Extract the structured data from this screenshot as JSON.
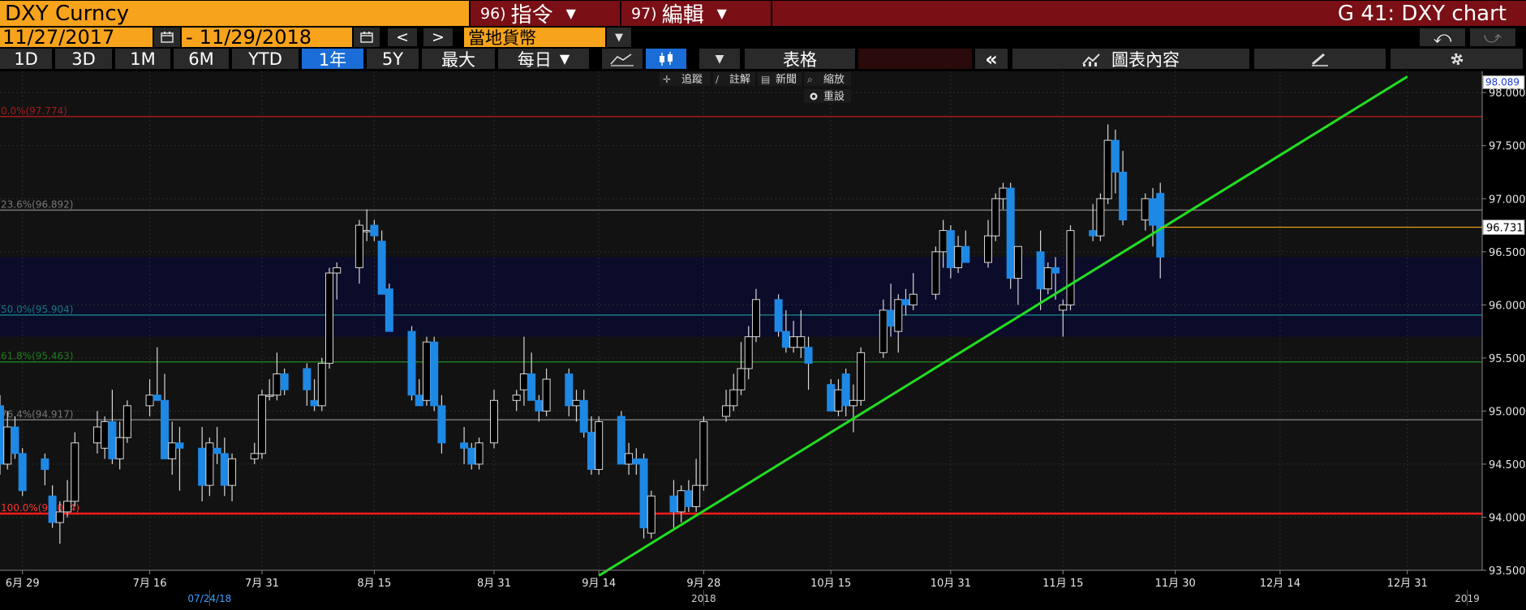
{
  "header": {
    "security": "DXY Curncy",
    "cmd96_num": "96)",
    "cmd96_label": "指令",
    "cmd97_num": "97)",
    "cmd97_label": "編輯",
    "title": "G 41: DXY chart"
  },
  "daterow": {
    "start_date": "11/27/2017",
    "dash": "-",
    "end_date": "11/29/2018",
    "prev": "<",
    "next": ">",
    "currency": "當地貨幣",
    "undo": "⤺",
    "redo": "⤻"
  },
  "toolbar": {
    "periods": [
      "1D",
      "3D",
      "1M",
      "6M",
      "YTD",
      "1年",
      "5Y",
      "最大"
    ],
    "active_period": "1年",
    "frequency": "每日",
    "table_label": "表格",
    "collapse": "«",
    "content_label": "圖表內容"
  },
  "minitools": {
    "track": "追蹤",
    "annotate": "註解",
    "news": "新聞",
    "zoom": "縮放",
    "reset": "重設"
  },
  "colors": {
    "up": "#000000",
    "down": "#1e88e5",
    "trend": "#22dd22",
    "retr_100": "#ff1a1a",
    "retr_0": "#a51b1b",
    "retr_236": "#777777",
    "retr_50": "#157a82",
    "retr_618": "#1f7a1f",
    "retr_764": "#777777",
    "last_line": "#e89a1a"
  },
  "chart_data": {
    "type": "candlestick",
    "ylim": [
      93.5,
      98.2
    ],
    "y_ticks": [
      93.5,
      94.0,
      94.5,
      95.0,
      95.5,
      96.0,
      96.5,
      97.0,
      97.5,
      98.0
    ],
    "y_tick_labels": [
      "93.500",
      "94.000",
      "94.500",
      "95.000",
      "95.500",
      "96.000",
      "96.500",
      "97.000",
      "97.500",
      "98.000"
    ],
    "xlim": [
      "2018-06-26",
      "2019-01-10"
    ],
    "x_ticks": [
      "2018-06-29",
      "2018-07-16",
      "2018-07-31",
      "2018-08-15",
      "2018-08-31",
      "2018-09-14",
      "2018-09-28",
      "2018-10-15",
      "2018-10-31",
      "2018-11-15",
      "2018-11-30",
      "2018-12-14",
      "2018-12-31"
    ],
    "x_tick_labels": [
      "6月 29",
      "7月 16",
      "7月 31",
      "8月 15",
      "8月 31",
      "9月 14",
      "9月 28",
      "10月 15",
      "10月 31",
      "11月 15",
      "11月 30",
      "12月 14",
      "12月 31"
    ],
    "sub_labels": [
      {
        "date": "2018-07-24",
        "text": "07/24/18",
        "highlight": true
      },
      {
        "date": "2018-09-28",
        "text": "2018",
        "highlight": false
      },
      {
        "date": "2019-01-08",
        "text": "2019",
        "highlight": false
      }
    ],
    "last_price": {
      "value": 96.731,
      "label": "96.731"
    },
    "top_price": {
      "value": 98.089,
      "label": "98.089"
    },
    "retracements": [
      {
        "value": 97.774,
        "label": "0.0%(97.774)",
        "key": "retr_0"
      },
      {
        "value": 96.892,
        "label": "23.6%(96.892)",
        "key": "retr_236"
      },
      {
        "value": 95.904,
        "label": "50.0%(95.904)",
        "key": "retr_50"
      },
      {
        "value": 95.463,
        "label": "61.8%(95.463)",
        "key": "retr_618"
      },
      {
        "value": 94.917,
        "label": "76.4%(94.917)",
        "key": "retr_764"
      },
      {
        "value": 94.034,
        "label": "100.0%(94.034)",
        "key": "retr_100"
      }
    ],
    "shaded_band": [
      95.7,
      96.45
    ],
    "trendline": [
      {
        "date": "2018-09-14",
        "value": 93.45
      },
      {
        "date": "2018-12-31",
        "value": 98.15
      }
    ],
    "candles": [
      [
        "2018-06-26",
        95.05,
        95.15,
        94.4,
        94.5
      ],
      [
        "2018-06-27",
        94.5,
        95.0,
        94.45,
        94.85
      ],
      [
        "2018-06-28",
        94.85,
        94.95,
        94.55,
        94.6
      ],
      [
        "2018-06-29",
        94.6,
        94.65,
        94.2,
        94.25
      ],
      [
        "2018-07-02",
        94.55,
        94.6,
        94.3,
        94.45
      ],
      [
        "2018-07-03",
        94.2,
        94.3,
        93.9,
        93.95
      ],
      [
        "2018-07-04",
        93.95,
        94.15,
        93.75,
        94.05
      ],
      [
        "2018-07-05",
        94.05,
        94.35,
        94.0,
        94.15
      ],
      [
        "2018-07-06",
        94.15,
        94.8,
        94.1,
        94.7
      ],
      [
        "2018-07-09",
        94.7,
        95.0,
        94.6,
        94.85
      ],
      [
        "2018-07-10",
        94.65,
        94.95,
        94.55,
        94.9
      ],
      [
        "2018-07-11",
        94.9,
        95.2,
        94.5,
        94.55
      ],
      [
        "2018-07-12",
        94.55,
        94.9,
        94.45,
        94.75
      ],
      [
        "2018-07-13",
        94.75,
        95.1,
        94.7,
        95.05
      ],
      [
        "2018-07-16",
        95.05,
        95.3,
        94.95,
        95.15
      ],
      [
        "2018-07-17",
        95.15,
        95.6,
        95.1,
        95.1
      ],
      [
        "2018-07-18",
        95.1,
        95.35,
        94.6,
        94.55
      ],
      [
        "2018-07-19",
        94.55,
        94.9,
        94.4,
        94.7
      ],
      [
        "2018-07-20",
        94.7,
        94.85,
        94.25,
        94.65
      ],
      [
        "2018-07-23",
        94.65,
        94.85,
        94.15,
        94.3
      ],
      [
        "2018-07-24",
        94.3,
        94.75,
        94.2,
        94.7
      ],
      [
        "2018-07-25",
        94.65,
        94.85,
        94.5,
        94.6
      ],
      [
        "2018-07-26",
        94.6,
        94.75,
        94.2,
        94.3
      ],
      [
        "2018-07-27",
        94.3,
        94.6,
        94.15,
        94.55
      ],
      [
        "2018-07-30",
        94.55,
        94.7,
        94.5,
        94.6
      ],
      [
        "2018-07-31",
        94.6,
        95.2,
        94.55,
        95.15
      ],
      [
        "2018-08-01",
        95.15,
        95.3,
        95.1,
        95.15
      ],
      [
        "2018-08-02",
        95.15,
        95.55,
        95.1,
        95.35
      ],
      [
        "2018-08-03",
        95.35,
        95.4,
        95.15,
        95.2
      ],
      [
        "2018-08-06",
        95.4,
        95.45,
        95.05,
        95.2
      ],
      [
        "2018-08-07",
        95.1,
        95.3,
        95.0,
        95.05
      ],
      [
        "2018-08-08",
        95.05,
        95.5,
        95.0,
        95.45
      ],
      [
        "2018-08-09",
        95.45,
        96.35,
        95.4,
        96.3
      ],
      [
        "2018-08-10",
        96.3,
        96.4,
        96.05,
        96.35
      ],
      [
        "2018-08-13",
        96.35,
        96.8,
        96.2,
        96.75
      ],
      [
        "2018-08-14",
        96.7,
        96.9,
        96.6,
        96.7
      ],
      [
        "2018-08-15",
        96.75,
        96.8,
        96.6,
        96.65
      ],
      [
        "2018-08-16",
        96.6,
        96.7,
        96.1,
        96.1
      ],
      [
        "2018-08-17",
        96.15,
        96.2,
        95.9,
        95.75
      ],
      [
        "2018-08-20",
        95.75,
        95.8,
        95.1,
        95.15
      ],
      [
        "2018-08-21",
        95.15,
        95.3,
        95.1,
        95.05
      ],
      [
        "2018-08-22",
        95.1,
        95.7,
        95.05,
        95.65
      ],
      [
        "2018-08-23",
        95.65,
        95.7,
        95.0,
        95.05
      ],
      [
        "2018-08-24",
        95.05,
        95.15,
        94.6,
        94.7
      ],
      [
        "2018-08-27",
        94.7,
        94.85,
        94.5,
        94.65
      ],
      [
        "2018-08-28",
        94.65,
        94.7,
        94.45,
        94.5
      ],
      [
        "2018-08-29",
        94.5,
        94.75,
        94.45,
        94.7
      ],
      [
        "2018-08-31",
        94.7,
        95.2,
        94.65,
        95.1
      ],
      [
        "2018-09-03",
        95.1,
        95.2,
        95.0,
        95.15
      ],
      [
        "2018-09-04",
        95.2,
        95.7,
        95.05,
        95.35
      ],
      [
        "2018-09-05",
        95.35,
        95.55,
        95.1,
        95.1
      ],
      [
        "2018-09-06",
        95.1,
        95.15,
        94.9,
        95.0
      ],
      [
        "2018-09-07",
        95.0,
        95.4,
        94.95,
        95.3
      ],
      [
        "2018-09-10",
        95.35,
        95.4,
        94.95,
        95.05
      ],
      [
        "2018-09-11",
        95.05,
        95.2,
        94.9,
        95.1
      ],
      [
        "2018-09-12",
        95.1,
        95.2,
        94.75,
        94.8
      ],
      [
        "2018-09-13",
        94.8,
        94.95,
        94.4,
        94.45
      ],
      [
        "2018-09-14",
        94.45,
        94.95,
        94.4,
        94.9
      ],
      [
        "2018-09-17",
        94.95,
        95.0,
        94.5,
        94.5
      ],
      [
        "2018-09-18",
        94.5,
        94.7,
        94.4,
        94.6
      ],
      [
        "2018-09-19",
        94.55,
        94.65,
        94.4,
        94.5
      ],
      [
        "2018-09-20",
        94.55,
        94.6,
        93.8,
        93.9
      ],
      [
        "2018-09-21",
        93.85,
        94.25,
        93.8,
        94.2
      ],
      [
        "2018-09-24",
        94.2,
        94.35,
        93.9,
        94.05
      ],
      [
        "2018-09-25",
        94.05,
        94.3,
        93.95,
        94.25
      ],
      [
        "2018-09-26",
        94.25,
        94.35,
        94.05,
        94.1
      ],
      [
        "2018-09-27",
        94.1,
        94.55,
        94.05,
        94.3
      ],
      [
        "2018-09-28",
        94.3,
        94.95,
        94.25,
        94.9
      ],
      [
        "2018-10-01",
        94.95,
        95.2,
        94.9,
        95.05
      ],
      [
        "2018-10-02",
        95.05,
        95.35,
        95.0,
        95.2
      ],
      [
        "2018-10-03",
        95.2,
        95.65,
        95.15,
        95.4
      ],
      [
        "2018-10-04",
        95.4,
        95.8,
        95.3,
        95.7
      ],
      [
        "2018-10-05",
        95.7,
        96.15,
        95.65,
        96.05
      ],
      [
        "2018-10-08",
        96.05,
        96.1,
        95.7,
        95.75
      ],
      [
        "2018-10-09",
        95.75,
        95.95,
        95.55,
        95.6
      ],
      [
        "2018-10-10",
        95.6,
        95.85,
        95.55,
        95.7
      ],
      [
        "2018-10-11",
        95.6,
        95.95,
        95.5,
        95.7
      ],
      [
        "2018-10-12",
        95.6,
        95.7,
        95.2,
        95.45
      ],
      [
        "2018-10-15",
        95.25,
        95.3,
        95.0,
        95.0
      ],
      [
        "2018-10-16",
        95.0,
        95.3,
        94.95,
        95.2
      ],
      [
        "2018-10-17",
        95.35,
        95.4,
        94.95,
        95.05
      ],
      [
        "2018-10-18",
        95.05,
        95.25,
        94.8,
        95.1
      ],
      [
        "2018-10-19",
        95.1,
        95.6,
        95.05,
        95.55
      ],
      [
        "2018-10-22",
        95.55,
        96.05,
        95.5,
        95.95
      ],
      [
        "2018-10-23",
        95.95,
        96.2,
        95.7,
        95.8
      ],
      [
        "2018-10-24",
        95.75,
        96.1,
        95.55,
        96.05
      ],
      [
        "2018-10-25",
        96.05,
        96.15,
        95.9,
        96.0
      ],
      [
        "2018-10-26",
        96.0,
        96.3,
        95.95,
        96.1
      ],
      [
        "2018-10-29",
        96.1,
        96.55,
        96.05,
        96.5
      ],
      [
        "2018-10-30",
        96.5,
        96.8,
        96.35,
        96.7
      ],
      [
        "2018-10-31",
        96.7,
        96.75,
        96.25,
        96.35
      ],
      [
        "2018-11-01",
        96.35,
        96.65,
        96.3,
        96.55
      ],
      [
        "2018-11-02",
        96.55,
        96.7,
        96.4,
        96.4
      ],
      [
        "2018-11-05",
        96.4,
        96.8,
        96.35,
        96.65
      ],
      [
        "2018-11-06",
        96.65,
        97.05,
        96.6,
        97.0
      ],
      [
        "2018-11-07",
        97.0,
        97.15,
        96.9,
        97.1
      ],
      [
        "2018-11-08",
        97.1,
        97.15,
        96.15,
        96.25
      ],
      [
        "2018-11-09",
        96.25,
        96.55,
        96.0,
        96.55
      ],
      [
        "2018-11-12",
        96.5,
        96.7,
        95.95,
        96.15
      ],
      [
        "2018-11-13",
        96.15,
        96.4,
        96.1,
        96.35
      ],
      [
        "2018-11-14",
        96.35,
        96.45,
        96.05,
        96.3
      ],
      [
        "2018-11-15",
        95.95,
        96.05,
        95.7,
        96.0
      ],
      [
        "2018-11-16",
        96.0,
        96.75,
        95.95,
        96.7
      ],
      [
        "2018-11-19",
        96.7,
        96.95,
        96.6,
        96.65
      ],
      [
        "2018-11-20",
        96.65,
        97.05,
        96.6,
        97.0
      ],
      [
        "2018-11-21",
        97.0,
        97.7,
        96.95,
        97.55
      ],
      [
        "2018-11-22",
        97.55,
        97.65,
        97.05,
        97.25
      ],
      [
        "2018-11-23",
        97.25,
        97.45,
        96.75,
        96.8
      ],
      [
        "2018-11-26",
        96.8,
        97.05,
        96.7,
        97.0
      ],
      [
        "2018-11-27",
        97.0,
        97.1,
        96.55,
        96.75
      ],
      [
        "2018-11-28",
        97.05,
        97.15,
        96.25,
        96.45
      ]
    ]
  }
}
